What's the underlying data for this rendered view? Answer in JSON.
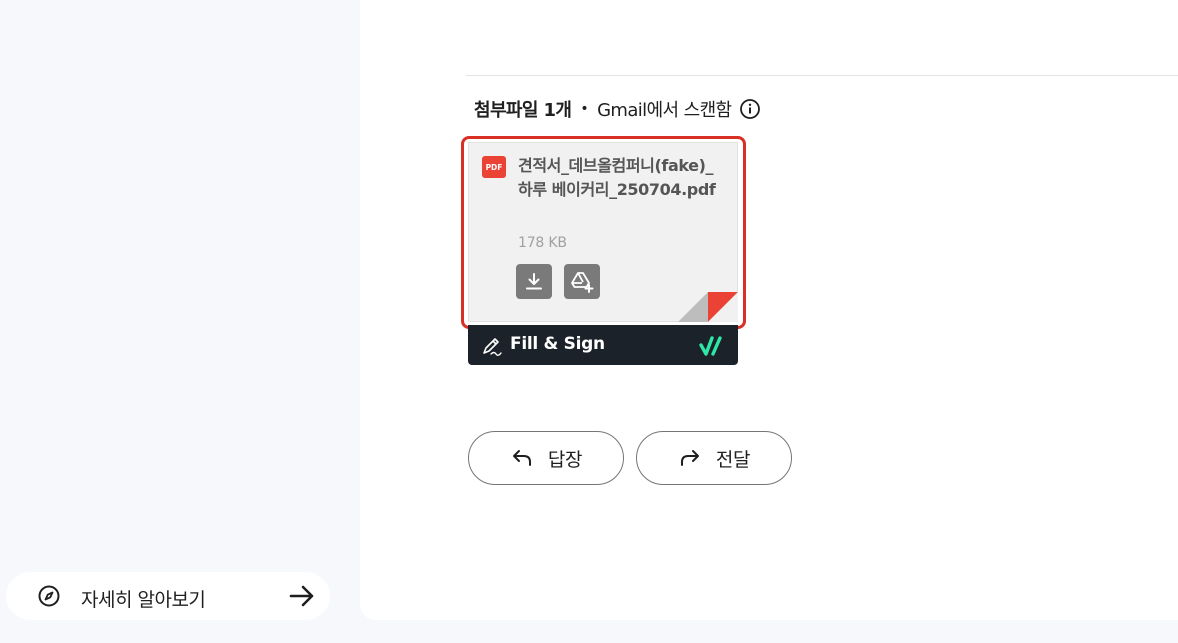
{
  "sidebar": {
    "learn_more_label": "자세히 알아보기",
    "learn_more_icon": "compass-icon",
    "arrow_icon": "arrow-right-icon"
  },
  "attachments": {
    "count_label": "첨부파일 1개",
    "separator": "•",
    "scan_label": "Gmail에서 스캔함",
    "info_icon": "info-icon",
    "file": {
      "type_badge": "PDF",
      "name": "견적서_데브올컴퍼니(fake)_하루 베이커리_250704.pdf",
      "size": "178 KB",
      "download_icon": "download-icon",
      "drive_icon": "add-to-drive-icon"
    },
    "fill_sign": {
      "label": "Fill & Sign",
      "icon": "pen-sign-icon"
    }
  },
  "actions": {
    "reply_label": "답장",
    "forward_label": "전달"
  },
  "colors": {
    "highlight": "#d93025",
    "pdf_red": "#ea4335",
    "fill_sign_bg": "#1b2229",
    "fill_sign_check": "#2ee6a6"
  }
}
